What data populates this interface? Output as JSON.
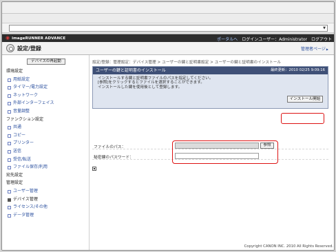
{
  "brand": {
    "name": "imageRUNNER ADVANCE",
    "portal_link": "ポータルへ",
    "login_user": "ログインユーザー：Administrator",
    "logout_link": "ログアウト"
  },
  "header": {
    "title": "設定/登録",
    "admin_link": "管理者ページ"
  },
  "sidebar": {
    "restart_button": "デバイスの再起動",
    "groups": [
      {
        "label": "環境設定",
        "items": [
          "用紙設定",
          "タイマー/電力設定",
          "ネットワーク",
          "外部インターフェイス",
          "音量調整"
        ]
      },
      {
        "label": "ファンクション設定",
        "items": [
          "共通",
          "コピー",
          "プリンター",
          "送信",
          "受信/転送",
          "ファイル保存/利用"
        ]
      },
      {
        "label": "宛先設定",
        "items": []
      },
      {
        "label": "管理設定",
        "items": [
          "ユーザー管理",
          "デバイス管理",
          "ライセンス/その他",
          "データ管理"
        ]
      }
    ],
    "selected_item": "デバイス管理"
  },
  "main": {
    "breadcrumb": "設定/登録：管理設定：デバイス管理 > ユーザーの鍵と証明書設定 > ユーザーの鍵と証明書のインストール",
    "panel": {
      "title": "ユーザーの鍵と証明書のインストール",
      "updated": "最終更新：2010 02/25 9:09:16",
      "desc_line1": "インストールする鍵と証明書ファイルのパスを指定してください。",
      "desc_line2": "[参照]をクリックするとファイルを選択することができます。",
      "desc_line3": "インストールした鍵を使用後として登録します。",
      "install_button": "インストール開始"
    },
    "form": {
      "file_path_label": "ファイルのパス：",
      "browse_button": "参照",
      "password_label": "秘密鍵のパスワード："
    },
    "copyright": "Copyright CANON INC. 2010 All Rights Reserved."
  }
}
